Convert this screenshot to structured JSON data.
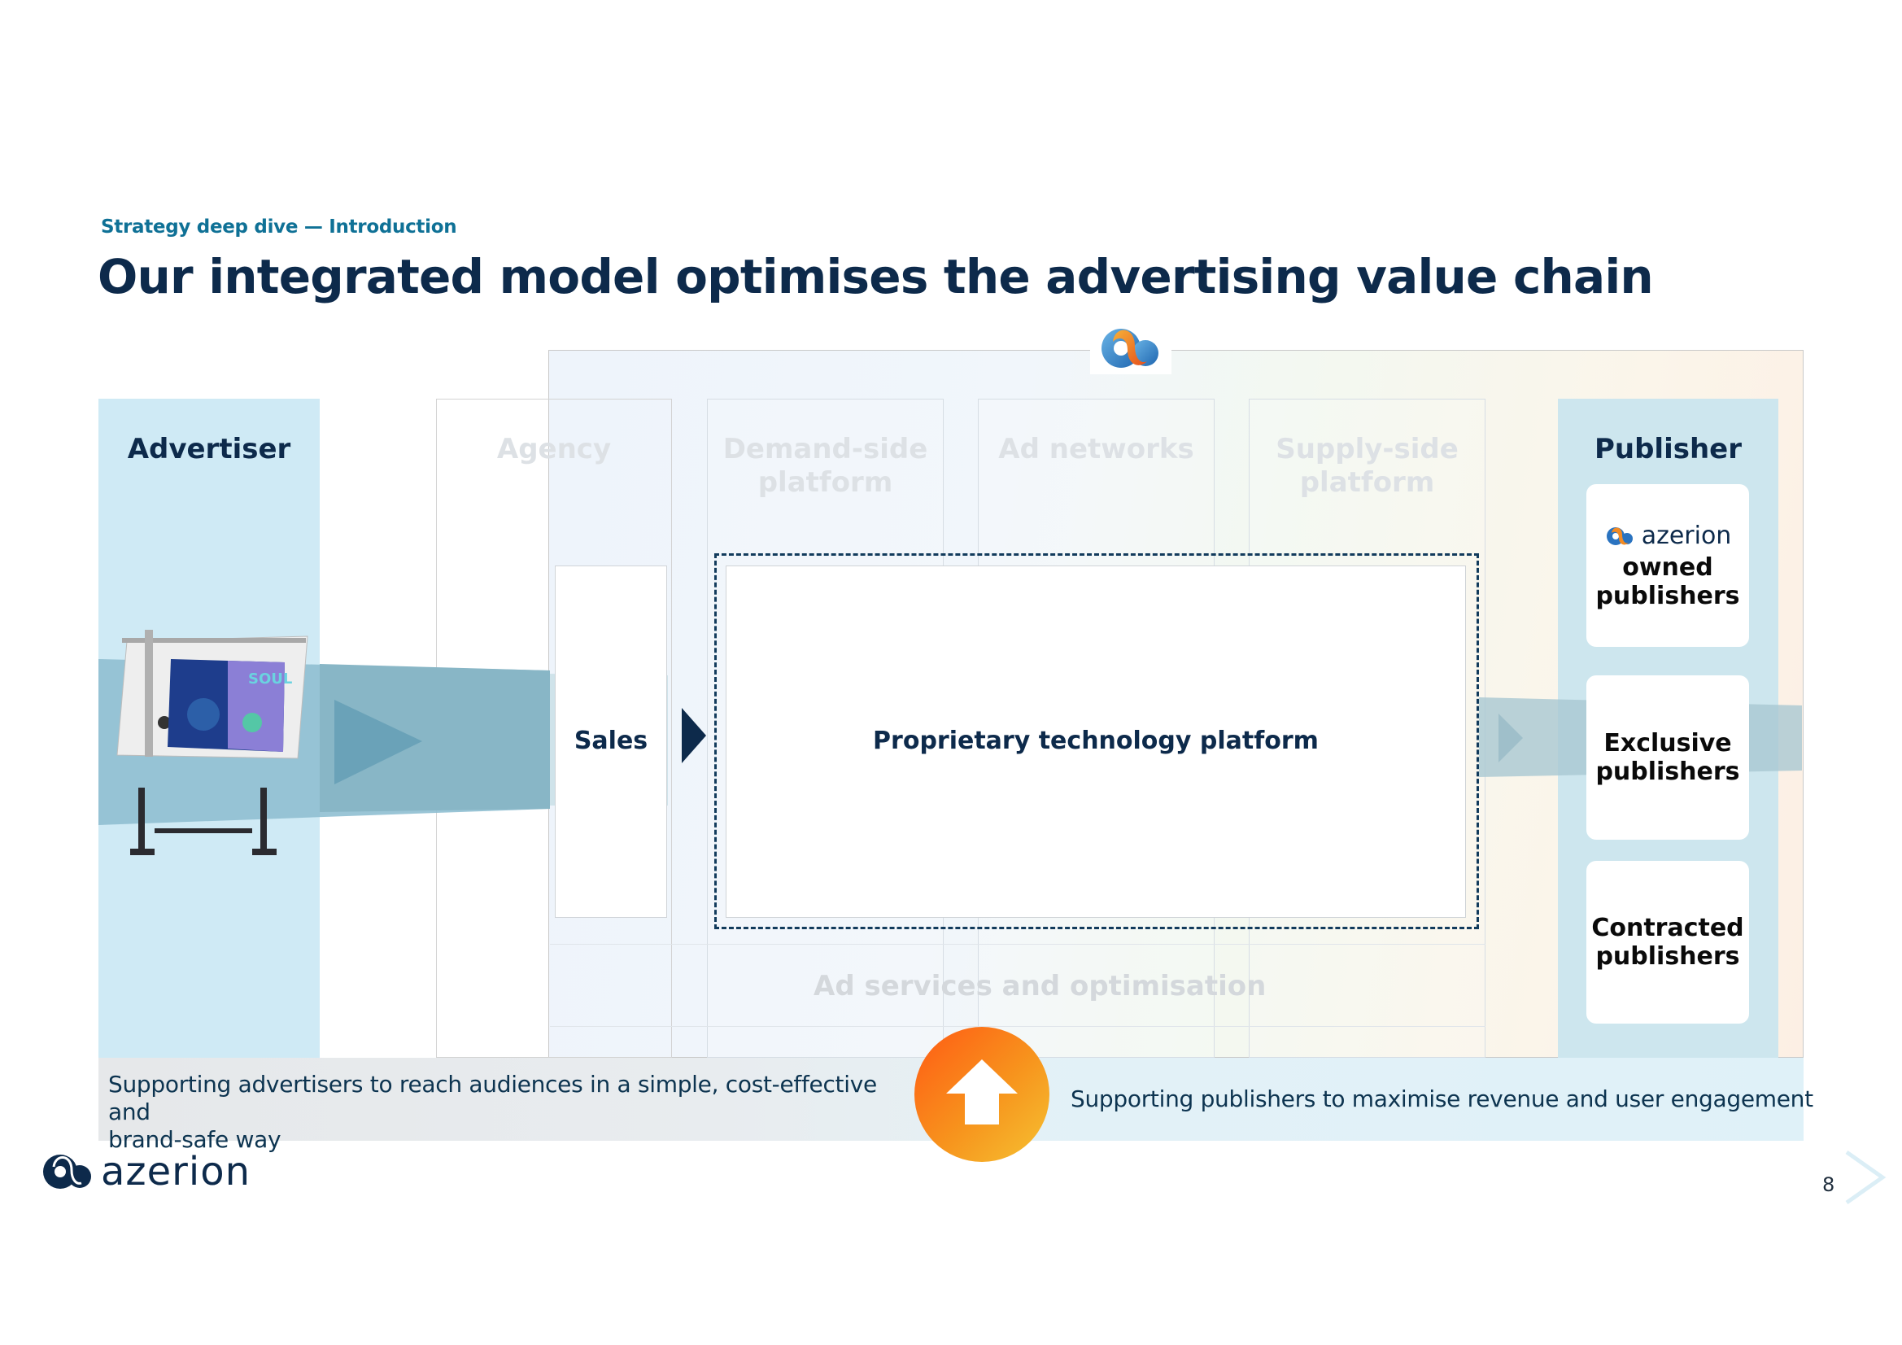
{
  "header": {
    "section": "Strategy deep dive — Introduction",
    "title": "Our integrated model optimises the advertising value chain"
  },
  "columns": {
    "advertiser": "Advertiser",
    "agency": "Agency",
    "dsp": "Demand-side platform",
    "dsp_line1": "Demand-side",
    "dsp_line2": "platform",
    "ad_networks": "Ad networks",
    "ssp_line1": "Supply-side",
    "ssp_line2": "platform",
    "publisher": "Publisher"
  },
  "diagram": {
    "sales": "Sales",
    "platform": "Proprietary technology platform",
    "services": "Ad services and optimisation",
    "advertiser_image": "Drafting-table billboard showing Soul movie poster"
  },
  "publishers": [
    {
      "brand": "azerion",
      "line1": "owned",
      "line2": "publishers"
    },
    {
      "line1": "Exclusive",
      "line2": "publishers"
    },
    {
      "line1": "Contracted",
      "line2": "publishers"
    }
  ],
  "bottom": {
    "advertisers_line1": "Supporting advertisers to reach audiences in a simple, cost-effective and",
    "advertisers_line2": "brand-safe way",
    "publishers": "Supporting publishers to maximise revenue and user engagement"
  },
  "footer": {
    "brand": "azerion",
    "page_number": "8"
  },
  "colors": {
    "navy": "#0d2a4b",
    "teal_subtitle": "#0f7196",
    "advertiser_bg": "#cfeaf5",
    "publisher_bg": "#cde6ee",
    "flow_band": "#8db8c7",
    "orange_start": "#ff5a14",
    "orange_end": "#f5c232"
  }
}
